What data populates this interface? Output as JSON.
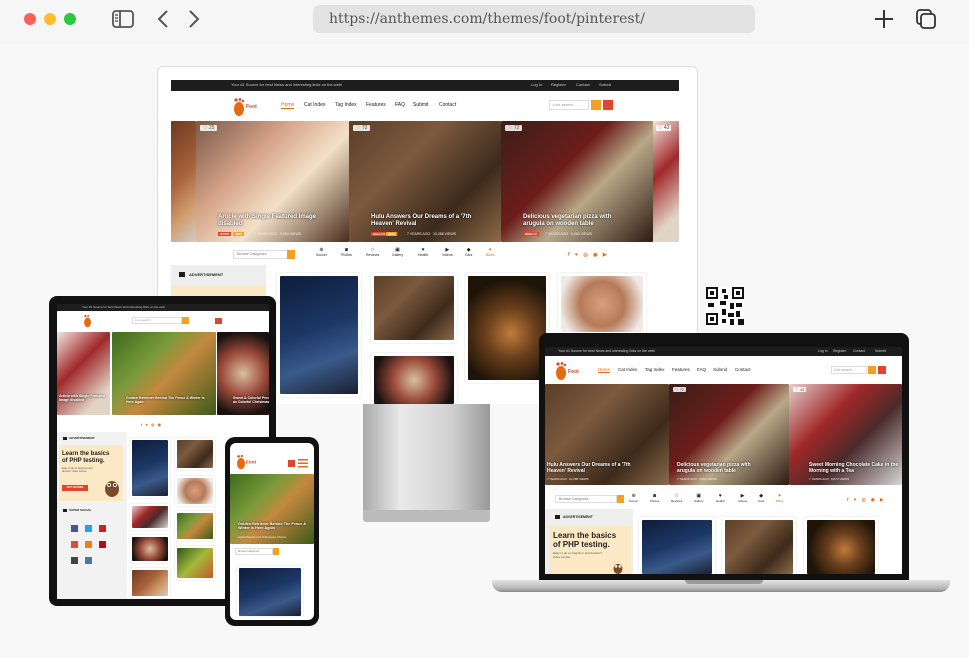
{
  "browser": {
    "url": "https://anthemes.com/themes/foot/pinterest/",
    "colors": {
      "close": "#fe5f57",
      "minimize": "#febc2e",
      "maximize": "#28c840"
    }
  },
  "site": {
    "topbar_text": "Your #1 Source for best News and interesting links on the web!",
    "login": "Log in",
    "register": "Register",
    "contact": "Contact",
    "submit": "Submit",
    "nav": [
      "Home",
      "Cat Index",
      "Tag Index",
      "Features",
      "FAQ",
      "Submit",
      "Contact"
    ],
    "search_placeholder": "Live search ...",
    "browse_categories": "Browse Categories",
    "categories": [
      "Soccer",
      "Photos",
      "Reviews",
      "Gallery",
      "Health",
      "Videos",
      "Cars",
      "Bikes"
    ],
    "advertisement": "ADVERTISEMENT",
    "ad": {
      "title_line1": "Learn the basics",
      "title_line2": "of PHP testing.",
      "sub": "Easy to do on beginner and deviser? video course.",
      "button": "GET COURSE"
    },
    "popular_social": "SUPER SOCIAL",
    "accent": "#e46b12",
    "red": "#e2452c"
  },
  "monitor": {
    "slides": [
      {
        "likes": "25",
        "title": "Article with Single Featured Image disabled",
        "tags": [
          "STATS",
          "NEW"
        ],
        "meta": [
          "7 YEARS AGO",
          "9,964 VIEWS"
        ]
      },
      {
        "likes": "72",
        "title": "Hulu Answers Our Dreams of a '7th Heaven' Revival",
        "tags": [
          "HEALTH",
          "NEW"
        ],
        "meta": [
          "7 YEARS AGO",
          "10,288 VIEWS"
        ]
      },
      {
        "likes": "72",
        "title": "Delicious vegetarian pizza with arugula on wooden table",
        "tags": [
          "HEALTH"
        ],
        "meta": [
          "7 YEARS AGO",
          "9,964 VIEWS"
        ]
      },
      {
        "likes": "43",
        "title": "",
        "tags": [],
        "meta": []
      }
    ]
  },
  "tablet": {
    "slides": [
      {
        "title": "Article with Single Featured Image disabled"
      },
      {
        "title": "Golden Retriever Behind The Fence & Winter Is Here Again"
      },
      {
        "title": "Sweet & Colorful Pens as Colorful Christmas"
      }
    ]
  },
  "phone": {
    "slide_title": "Golden Retriever Behind The Fence & Winter Is Here Again",
    "slide_meta": "Ligula Pharetra Cera Pellentesque Chelone"
  },
  "laptop": {
    "slides": [
      {
        "likes": "",
        "title": "Hulu Answers Our Dreams of a '7th Heaven' Revival",
        "meta": [
          "7 YEARS AGO",
          "10,288 VIEWS"
        ]
      },
      {
        "likes": "72",
        "title": "Delicious vegetarian pizza with arugula on wooden table",
        "meta": [
          "7 YEARS AGO",
          "9,964 VIEWS"
        ]
      },
      {
        "likes": "43",
        "title": "Sweet Morning Chocolate Cake in the Morning with a Tea",
        "meta": [
          "7 YEARS AGO",
          "8,874 VIEWS"
        ]
      }
    ]
  }
}
